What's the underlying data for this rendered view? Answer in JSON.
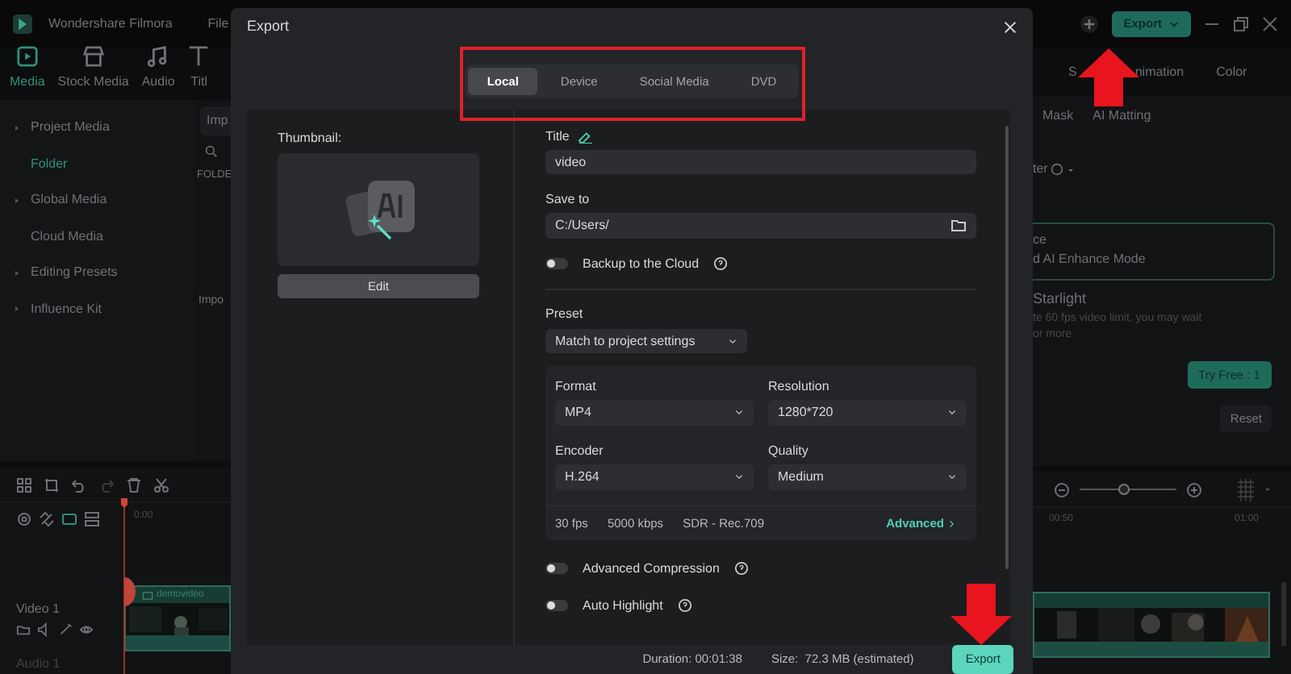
{
  "app": {
    "title": "Wondershare Filmora",
    "menu": [
      "File"
    ],
    "export_button": "Export"
  },
  "left_tabs": [
    {
      "label": "Media",
      "selected": true
    },
    {
      "label": "Stock Media",
      "selected": false
    },
    {
      "label": "Audio",
      "selected": false
    },
    {
      "label": "Titl",
      "selected": false
    }
  ],
  "right_tabs": [
    {
      "label": "S"
    },
    {
      "label": "nimation"
    },
    {
      "label": "Color"
    }
  ],
  "media_sidebar": [
    {
      "label": "Project Media",
      "expandable": true,
      "selected": false
    },
    {
      "label": "Folder",
      "expandable": false,
      "selected": true
    },
    {
      "label": "Global Media",
      "expandable": true,
      "selected": false
    },
    {
      "label": "Cloud Media",
      "expandable": false,
      "selected": false
    },
    {
      "label": "Editing Presets",
      "expandable": true,
      "selected": false
    },
    {
      "label": "Influence Kit",
      "expandable": true,
      "selected": false
    }
  ],
  "media_panel": {
    "import_button": "Imp",
    "folder_header": "FOLDE",
    "import_hint": "Impo"
  },
  "properties_panel": {
    "sub_tabs": [
      "Mask",
      "AI Matting"
    ],
    "section_label": "ter",
    "enhance_box": {
      "title": "ce",
      "subtitle": "d AI Enhance Mode"
    },
    "starlight": {
      "title": "Starlight",
      "lines": [
        "te 60 fps video limit, you may wait",
        "or more"
      ]
    },
    "try_button": "Try Free : 1",
    "reset_button": "Reset"
  },
  "timeline": {
    "ruler_left": [
      "0:00"
    ],
    "ruler_right": [
      "00:50",
      "01:00"
    ],
    "zoom": {
      "level": 0.45
    },
    "tracks": [
      "Video 1",
      "Audio 1"
    ],
    "clip": {
      "label": "demovideo"
    }
  },
  "dialog": {
    "title": "Export",
    "tabs": [
      {
        "label": "Local",
        "selected": true
      },
      {
        "label": "Device",
        "selected": false
      },
      {
        "label": "Social Media",
        "selected": false
      },
      {
        "label": "DVD",
        "selected": false
      }
    ],
    "thumbnail_label": "Thumbnail:",
    "edit_button": "Edit",
    "title_label": "Title",
    "title_value": "video",
    "save_label": "Save to",
    "save_value": "C:/Users/",
    "backup": {
      "label": "Backup to the Cloud",
      "on": false
    },
    "preset_label": "Preset",
    "preset_value": "Match to project settings",
    "settings": [
      {
        "label": "Format",
        "value": "MP4"
      },
      {
        "label": "Resolution",
        "value": "1280*720"
      },
      {
        "label": "Encoder",
        "value": "H.264"
      },
      {
        "label": "Quality",
        "value": "Medium"
      }
    ],
    "summary": [
      "30 fps",
      "5000 kbps",
      "SDR - Rec.709"
    ],
    "advanced_link": "Advanced",
    "options": [
      {
        "label": "Advanced Compression",
        "on": false
      },
      {
        "label": "Auto Highlight",
        "on": false
      }
    ],
    "duration": "Duration: 00:01:38",
    "size": "Size:  72.3 MB (estimated)",
    "export_button": "Export"
  }
}
